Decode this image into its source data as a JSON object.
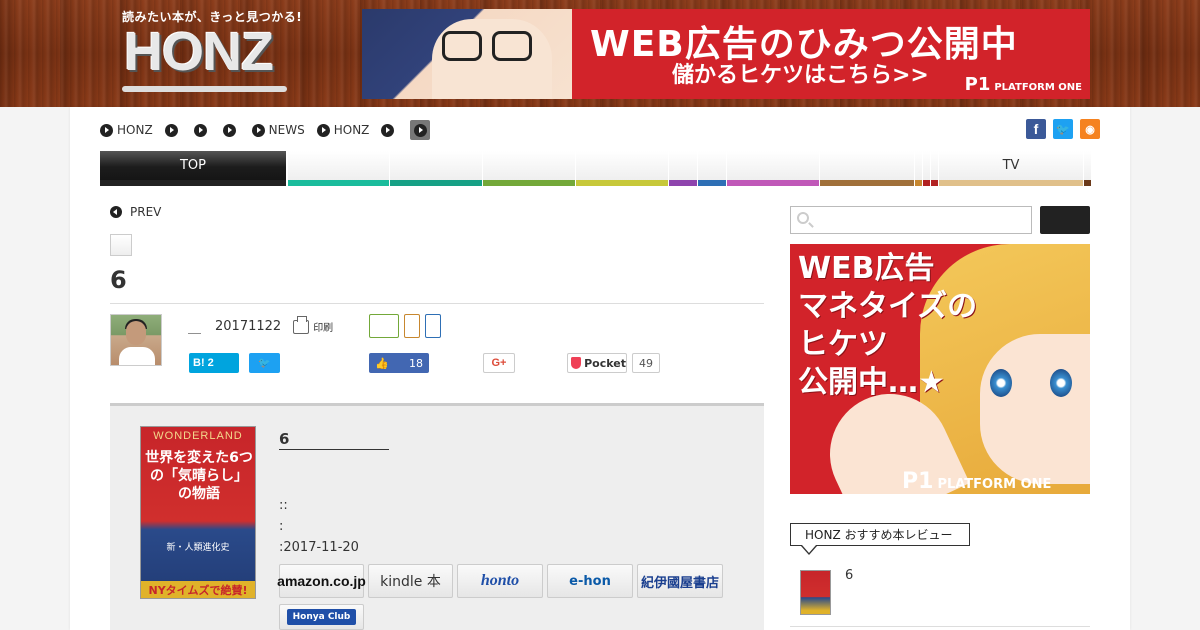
{
  "header": {
    "logo_tagline": "読みたい本が、きっと見つかる!",
    "logo_text": "HONZ",
    "banner": {
      "headline": "WEB広告のひみつ公開中",
      "subline": "儲かるヒケツはこちら>>",
      "brand_mark": "P1",
      "brand": "PLATFORM ONE"
    }
  },
  "breadcrumb": {
    "items": [
      {
        "label": "HONZ"
      },
      {
        "label": ""
      },
      {
        "label": ""
      },
      {
        "label": ""
      },
      {
        "label": "NEWS"
      },
      {
        "label": "HONZ"
      },
      {
        "label": ""
      },
      {
        "label": ""
      }
    ]
  },
  "social_icons": [
    "facebook-icon",
    "twitter-icon",
    "rss-icon"
  ],
  "category_nav": {
    "items": [
      {
        "label": "TOP",
        "color": "#222222"
      },
      {
        "label": "",
        "color": "#1abc9c"
      },
      {
        "label": "",
        "color": "#16a085"
      },
      {
        "label": "",
        "color": "#73a839"
      },
      {
        "label": "",
        "color": "#c7c83a"
      },
      {
        "label": "",
        "color": "#8e44ad"
      },
      {
        "label": "",
        "color": "#2e6fb5"
      },
      {
        "label": "",
        "color": "#c058b8"
      },
      {
        "label": "",
        "color": "#a0703a"
      },
      {
        "label": "",
        "color": "#c7872f"
      },
      {
        "label": "",
        "color": "#b22222"
      },
      {
        "label": "",
        "color": "#b22222"
      },
      {
        "label": "TV",
        "color": "#e0c08a"
      },
      {
        "label": "",
        "color": "#6b3a1a"
      }
    ]
  },
  "article": {
    "prev_label": "PREV",
    "title": "6",
    "author": "＿",
    "date": "20171122",
    "print_label": "印刷",
    "tag_colors": [
      "#73a839",
      "#c7872f",
      "#2e6fb5"
    ],
    "share": {
      "hatena_label": "B!",
      "hatena_count": "2",
      "facebook_count": "18",
      "gplus_label": "G+",
      "pocket_label": "Pocket",
      "pocket_count": "49"
    }
  },
  "book": {
    "title": "6",
    "line1": "::",
    "line2": ":",
    "date_line": ":2017-11-20",
    "cover": {
      "series": "WONDERLAND",
      "title": "世界を変えた6つの「気晴らし」の物語",
      "subtitle": "新・人類進化史",
      "band": "NYタイムズで絶賛!"
    },
    "stores": [
      {
        "label": "amazon.co.jp"
      },
      {
        "label": "kindle 本"
      },
      {
        "label": "honto"
      },
      {
        "label": "e-hon"
      },
      {
        "label": "紀伊國屋書店"
      },
      {
        "label": "Honya Club"
      }
    ]
  },
  "sidebar": {
    "ad": {
      "lines": [
        "WEB広告",
        "マネタイズの",
        "ヒケツ",
        "公開中…★"
      ],
      "brand_mark": "P1",
      "brand": "PLATFORM ONE"
    },
    "recommend_label": "HONZ おすすめ本レビュー",
    "recommend_item": "6"
  }
}
